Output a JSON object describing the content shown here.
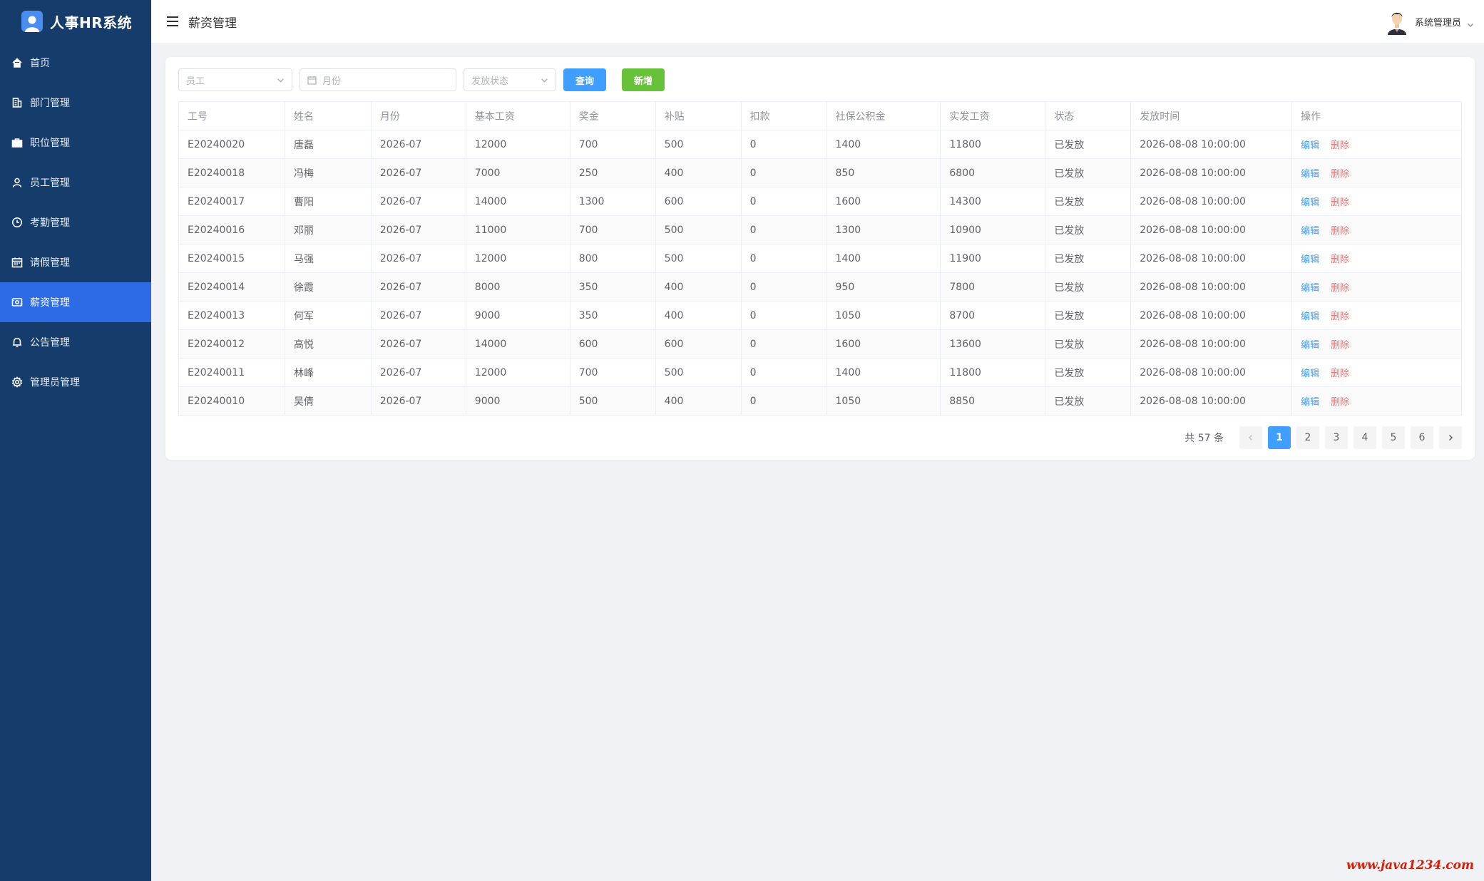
{
  "brand": {
    "title": "人事HR系统"
  },
  "sidebar": {
    "items": [
      {
        "label": "首页",
        "icon": "home-icon"
      },
      {
        "label": "部门管理",
        "icon": "building-icon"
      },
      {
        "label": "职位管理",
        "icon": "briefcase-icon"
      },
      {
        "label": "员工管理",
        "icon": "user-icon"
      },
      {
        "label": "考勤管理",
        "icon": "clock-icon"
      },
      {
        "label": "请假管理",
        "icon": "calendar-icon"
      },
      {
        "label": "薪资管理",
        "icon": "wallet-icon",
        "active": true
      },
      {
        "label": "公告管理",
        "icon": "bell-icon"
      },
      {
        "label": "管理员管理",
        "icon": "gear-icon"
      }
    ]
  },
  "header": {
    "title": "薪资管理",
    "user_name": "系统管理员"
  },
  "filters": {
    "employee_placeholder": "员工",
    "month_placeholder": "月份",
    "status_placeholder": "发放状态",
    "query_label": "查询",
    "add_label": "新增"
  },
  "table": {
    "columns": [
      "工号",
      "姓名",
      "月份",
      "基本工资",
      "奖金",
      "补贴",
      "扣款",
      "社保公积金",
      "实发工资",
      "状态",
      "发放时间",
      "操作"
    ],
    "rows": [
      [
        "E20240020",
        "唐磊",
        "2026-07",
        "12000",
        "700",
        "500",
        "0",
        "1400",
        "11800",
        "已发放",
        "2026-08-08 10:00:00"
      ],
      [
        "E20240018",
        "冯梅",
        "2026-07",
        "7000",
        "250",
        "400",
        "0",
        "850",
        "6800",
        "已发放",
        "2026-08-08 10:00:00"
      ],
      [
        "E20240017",
        "曹阳",
        "2026-07",
        "14000",
        "1300",
        "600",
        "0",
        "1600",
        "14300",
        "已发放",
        "2026-08-08 10:00:00"
      ],
      [
        "E20240016",
        "邓丽",
        "2026-07",
        "11000",
        "700",
        "500",
        "0",
        "1300",
        "10900",
        "已发放",
        "2026-08-08 10:00:00"
      ],
      [
        "E20240015",
        "马强",
        "2026-07",
        "12000",
        "800",
        "500",
        "0",
        "1400",
        "11900",
        "已发放",
        "2026-08-08 10:00:00"
      ],
      [
        "E20240014",
        "徐霞",
        "2026-07",
        "8000",
        "350",
        "400",
        "0",
        "950",
        "7800",
        "已发放",
        "2026-08-08 10:00:00"
      ],
      [
        "E20240013",
        "何军",
        "2026-07",
        "9000",
        "350",
        "400",
        "0",
        "1050",
        "8700",
        "已发放",
        "2026-08-08 10:00:00"
      ],
      [
        "E20240012",
        "高悦",
        "2026-07",
        "14000",
        "600",
        "600",
        "0",
        "1600",
        "13600",
        "已发放",
        "2026-08-08 10:00:00"
      ],
      [
        "E20240011",
        "林峰",
        "2026-07",
        "12000",
        "700",
        "500",
        "0",
        "1400",
        "11800",
        "已发放",
        "2026-08-08 10:00:00"
      ],
      [
        "E20240010",
        "吴倩",
        "2026-07",
        "9000",
        "500",
        "400",
        "0",
        "1050",
        "8850",
        "已发放",
        "2026-08-08 10:00:00"
      ]
    ],
    "edit_label": "编辑",
    "delete_label": "删除"
  },
  "pagination": {
    "total_text": "共 57 条",
    "pages": [
      "1",
      "2",
      "3",
      "4",
      "5",
      "6"
    ],
    "current": "1"
  },
  "watermark": "www.java1234.com",
  "colors": {
    "sidebar_bg": "#153c6b",
    "active": "#2d6ae6",
    "primary": "#409eff",
    "success": "#67c23a",
    "danger": "#f56c6c"
  }
}
